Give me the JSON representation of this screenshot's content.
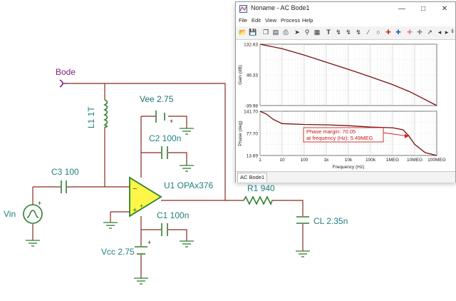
{
  "schematic": {
    "bode_label": "Bode",
    "l1_label": "L1 1T",
    "vee_label": "Vee 2.75",
    "c2_label": "C2 100n",
    "c3_label": "C3 100",
    "u1_label": "U1 OPAx376",
    "r1_label": "R1 940",
    "vin_label": "Vin",
    "c1_label": "C1 100n",
    "cl_label": "CL 2.35n",
    "vcc_label": "Vcc 2.75",
    "minus_sign": "−",
    "plus_sign": "+"
  },
  "window": {
    "title": "Noname - AC Bode1",
    "minimize": "—",
    "maximize": "□",
    "close": "✕",
    "menus": [
      "File",
      "Edit",
      "View",
      "Process",
      "Help"
    ],
    "tab": "AC Bode1"
  },
  "toolbar": {
    "icons": [
      "open-icon",
      "save-icon",
      "copy-icon",
      "paste-icon",
      "print-icon",
      "pointer-icon",
      "zoom-icon",
      "zoom-box-icon",
      "text-icon",
      "link-icon",
      "link2-icon",
      "link3-icon",
      "line-icon",
      "circle-icon",
      "cursor-icon",
      "cursor2-icon",
      "marker-icon",
      "marker2-icon",
      "arrow-icon",
      "prev-icon",
      "next-icon",
      "spin-icon"
    ]
  },
  "chart_data": [
    {
      "type": "line",
      "ylabel": "Gain (dB)",
      "xscale": "log",
      "ylim": [
        -39.98,
        132.63
      ],
      "yticks": [
        "132.63",
        "46.33",
        "-39.98"
      ],
      "series": [
        {
          "color": "#7a1010",
          "x": [
            1,
            10,
            100,
            1000,
            10000,
            100000,
            1000000,
            5490000,
            10000000,
            100000000
          ],
          "y": [
            132.63,
            120,
            102,
            82,
            62,
            41,
            19,
            0,
            -8,
            -39.98
          ]
        }
      ]
    },
    {
      "type": "line",
      "xlabel": "Frequency (Hz)",
      "ylabel": "Phase (deg)",
      "xscale": "log",
      "ylim": [
        13.69,
        141.7
      ],
      "yticks": [
        "141.70",
        "77.70",
        "13.69"
      ],
      "xticks": [
        "1",
        "10",
        "100",
        "1k",
        "10k",
        "100k",
        "1MEG",
        "10MEG",
        "100MEG"
      ],
      "series": [
        {
          "color": "#7a1010",
          "x": [
            1,
            2,
            4,
            10,
            100,
            1000,
            10000,
            100000,
            1000000,
            3000000,
            5490000,
            10000000,
            30000000,
            100000000
          ],
          "y": [
            141.7,
            133,
            118,
            106,
            103.5,
            102.5,
            100,
            96,
            94,
            88,
            70.05,
            46,
            22,
            13.69
          ]
        }
      ],
      "annotation": {
        "line1": "Phase margin: 70.05",
        "line2": "at frequency (Hz): 5.49MEG"
      }
    }
  ]
}
